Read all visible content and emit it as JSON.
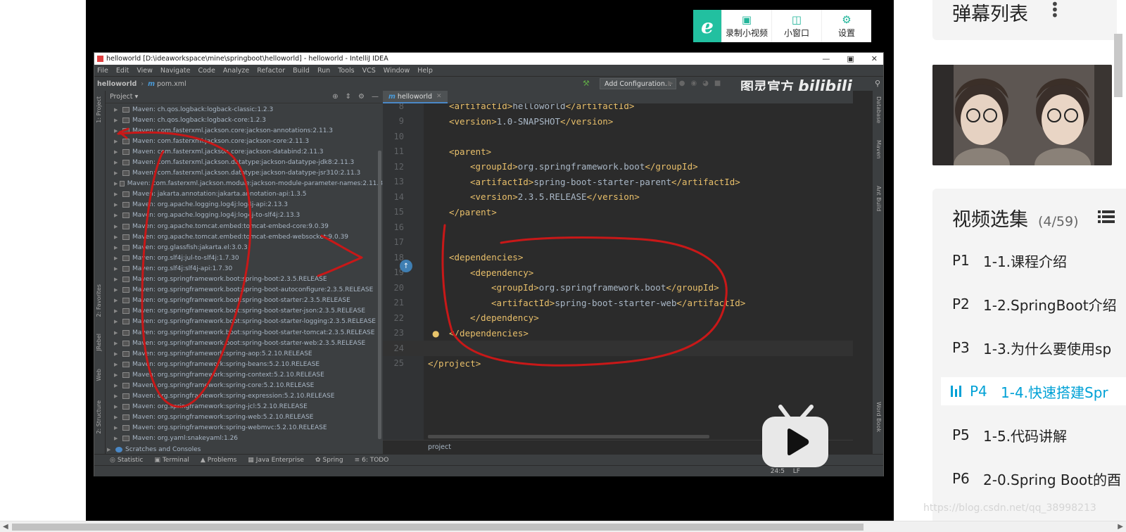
{
  "mini_toolbar": {
    "logo": "e",
    "record_label": "录制小视频",
    "mini_window_label": "小窗口",
    "settings_label": "设置"
  },
  "ide": {
    "window_title": "helloworld [D:\\ideaworkspace\\mine\\springboot\\helloworld] - helloworld - IntelliJ IDEA",
    "menu": [
      "File",
      "Edit",
      "View",
      "Navigate",
      "Code",
      "Analyze",
      "Refactor",
      "Build",
      "Run",
      "Tools",
      "VCS",
      "Window",
      "Help"
    ],
    "breadcrumb": [
      "helloworld",
      "pom.xml"
    ],
    "add_configuration": "Add Configuration...",
    "watermark": "图灵官方",
    "watermark_logo": "bilibili",
    "project_header": "Project",
    "project_items": [
      "Maven: ch.qos.logback:logback-classic:1.2.3",
      "Maven: ch.qos.logback:logback-core:1.2.3",
      "Maven: com.fasterxml.jackson.core:jackson-annotations:2.11.3",
      "Maven: com.fasterxml.jackson.core:jackson-core:2.11.3",
      "Maven: com.fasterxml.jackson.core:jackson-databind:2.11.3",
      "Maven: com.fasterxml.jackson.datatype:jackson-datatype-jdk8:2.11.3",
      "Maven: com.fasterxml.jackson.datatype:jackson-datatype-jsr310:2.11.3",
      "Maven: com.fasterxml.jackson.module:jackson-module-parameter-names:2.11.3",
      "Maven: jakarta.annotation:jakarta.annotation-api:1.3.5",
      "Maven: org.apache.logging.log4j:log4j-api:2.13.3",
      "Maven: org.apache.logging.log4j:log4j-to-slf4j:2.13.3",
      "Maven: org.apache.tomcat.embed:tomcat-embed-core:9.0.39",
      "Maven: org.apache.tomcat.embed:tomcat-embed-websocket:9.0.39",
      "Maven: org.glassfish:jakarta.el:3.0.3",
      "Maven: org.slf4j:jul-to-slf4j:1.7.30",
      "Maven: org.slf4j:slf4j-api:1.7.30",
      "Maven: org.springframework.boot:spring-boot:2.3.5.RELEASE",
      "Maven: org.springframework.boot:spring-boot-autoconfigure:2.3.5.RELEASE",
      "Maven: org.springframework.boot:spring-boot-starter:2.3.5.RELEASE",
      "Maven: org.springframework.boot:spring-boot-starter-json:2.3.5.RELEASE",
      "Maven: org.springframework.boot:spring-boot-starter-logging:2.3.5.RELEASE",
      "Maven: org.springframework.boot:spring-boot-starter-tomcat:2.3.5.RELEASE",
      "Maven: org.springframework.boot:spring-boot-starter-web:2.3.5.RELEASE",
      "Maven: org.springframework:spring-aop:5.2.10.RELEASE",
      "Maven: org.springframework:spring-beans:5.2.10.RELEASE",
      "Maven: org.springframework:spring-context:5.2.10.RELEASE",
      "Maven: org.springframework:spring-core:5.2.10.RELEASE",
      "Maven: org.springframework:spring-expression:5.2.10.RELEASE",
      "Maven: org.springframework:spring-jcl:5.2.10.RELEASE",
      "Maven: org.springframework:spring-web:5.2.10.RELEASE",
      "Maven: org.springframework:spring-webmvc:5.2.10.RELEASE",
      "Maven: org.yaml:snakeyaml:1.26"
    ],
    "scratches_label": "Scratches and Consoles",
    "editor_tab": "helloworld",
    "code_lines": [
      {
        "n": "8",
        "indent": 1,
        "open": "<artifactId>",
        "value": "helloworld",
        "close": "</artifactId>"
      },
      {
        "n": "9",
        "indent": 1,
        "open": "<version>",
        "value": "1.0-SNAPSHOT",
        "close": "</version>"
      },
      {
        "n": "10",
        "indent": 0,
        "open": "",
        "value": "",
        "close": ""
      },
      {
        "n": "11",
        "indent": 1,
        "open": "<parent>",
        "value": "",
        "close": ""
      },
      {
        "n": "12",
        "indent": 2,
        "open": "<groupId>",
        "value": "org.springframework.boot",
        "close": "</groupId>"
      },
      {
        "n": "13",
        "indent": 2,
        "open": "<artifactId>",
        "value": "spring-boot-starter-parent",
        "close": "</artifactId>"
      },
      {
        "n": "14",
        "indent": 2,
        "open": "<version>",
        "value": "2.3.5.RELEASE",
        "close": "</version>"
      },
      {
        "n": "15",
        "indent": 1,
        "open": "</parent>",
        "value": "",
        "close": ""
      },
      {
        "n": "16",
        "indent": 0,
        "open": "",
        "value": "",
        "close": ""
      },
      {
        "n": "17",
        "indent": 0,
        "open": "",
        "value": "",
        "close": ""
      },
      {
        "n": "18",
        "indent": 1,
        "open": "<dependencies>",
        "value": "",
        "close": ""
      },
      {
        "n": "19",
        "indent": 2,
        "open": "<dependency>",
        "value": "",
        "close": ""
      },
      {
        "n": "20",
        "indent": 3,
        "open": "<groupId>",
        "value": "org.springframework.boot",
        "close": "</groupId>"
      },
      {
        "n": "21",
        "indent": 3,
        "open": "<artifactId>",
        "value": "spring-boot-starter-web",
        "close": "</artifactId>"
      },
      {
        "n": "22",
        "indent": 2,
        "open": "</dependency>",
        "value": "",
        "close": ""
      },
      {
        "n": "23",
        "indent": 1,
        "open": "</dependencies>",
        "value": "",
        "close": ""
      },
      {
        "n": "24",
        "indent": 0,
        "open": "",
        "value": "",
        "close": ""
      },
      {
        "n": "25",
        "indent": 0,
        "open": "</project>",
        "value": "",
        "close": ""
      }
    ],
    "editor_breadcrumb": "project",
    "tool_windows": [
      "Statistic",
      "Terminal",
      "Problems",
      "Java Enterprise",
      "Spring",
      "6: TODO"
    ],
    "cursor_position": "24:5",
    "line_separator": "LF"
  },
  "right_panel": {
    "danmaku_title": "弹幕列表",
    "playlist_title": "视频选集",
    "playlist_count": "(4/59)",
    "items": [
      {
        "part": "P1",
        "title": "1-1.课程介绍"
      },
      {
        "part": "P2",
        "title": "1-2.SpringBoot介绍"
      },
      {
        "part": "P3",
        "title": "1-3.为什么要使用sp"
      },
      {
        "part": "P4",
        "title": "1-4.快速搭建Spr"
      },
      {
        "part": "P5",
        "title": "1-5.代码讲解"
      },
      {
        "part": "P6",
        "title": "2-0.Spring Boot的酉"
      }
    ],
    "active_index": 3,
    "watermark": "https://blog.csdn.net/qq_38998213"
  },
  "colors": {
    "bilibili_blue": "#00a1d6",
    "annotation_red": "#c81818",
    "ide_bg": "#2b2b2b",
    "xml_tag": "#e8bf6a"
  }
}
